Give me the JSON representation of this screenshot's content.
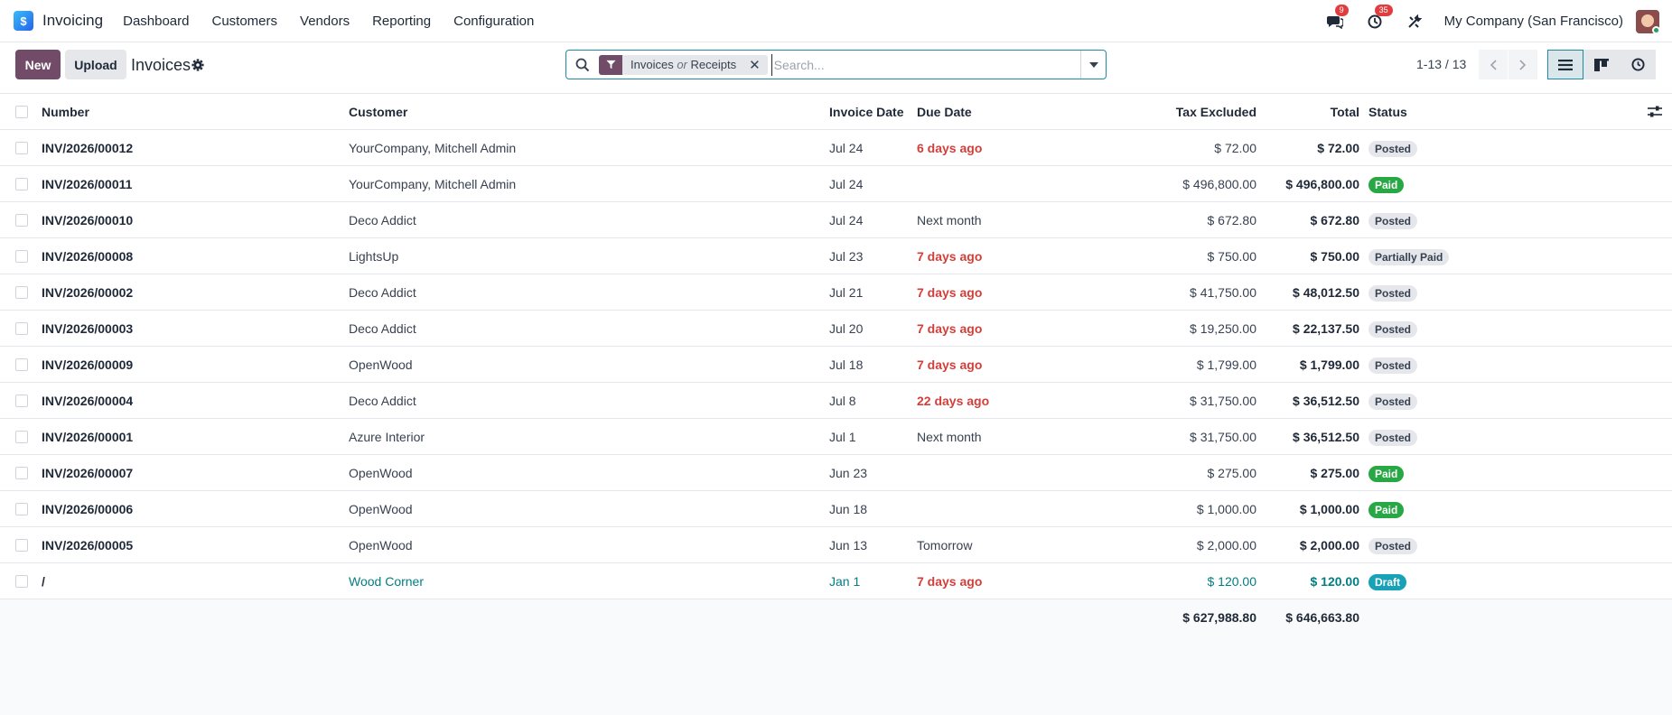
{
  "app": {
    "name": "Invoicing"
  },
  "menu": [
    "Dashboard",
    "Customers",
    "Vendors",
    "Reporting",
    "Configuration"
  ],
  "nav": {
    "messages_count": "9",
    "activities_count": "35",
    "company": "My Company (San Francisco)"
  },
  "control": {
    "new_label": "New",
    "upload_label": "Upload",
    "breadcrumb": "Invoices",
    "facet_a": "Invoices",
    "facet_or": "or",
    "facet_b": "Receipts",
    "search_placeholder": "Search...",
    "pager": "1-13 / 13"
  },
  "columns": {
    "number": "Number",
    "customer": "Customer",
    "invoice_date": "Invoice Date",
    "due_date": "Due Date",
    "tax_excluded": "Tax Excluded",
    "total": "Total",
    "status": "Status"
  },
  "rows": [
    {
      "number": "INV/2026/00012",
      "customer": "YourCompany, Mitchell Admin",
      "invoice_date": "Jul 24",
      "due_date": "6 days ago",
      "overdue": true,
      "tax_excluded": "$ 72.00",
      "total": "$ 72.00",
      "status": "Posted"
    },
    {
      "number": "INV/2026/00011",
      "customer": "YourCompany, Mitchell Admin",
      "invoice_date": "Jul 24",
      "due_date": "",
      "overdue": false,
      "tax_excluded": "$ 496,800.00",
      "total": "$ 496,800.00",
      "status": "Paid"
    },
    {
      "number": "INV/2026/00010",
      "customer": "Deco Addict",
      "invoice_date": "Jul 24",
      "due_date": "Next month",
      "overdue": false,
      "tax_excluded": "$ 672.80",
      "total": "$ 672.80",
      "status": "Posted"
    },
    {
      "number": "INV/2026/00008",
      "customer": "LightsUp",
      "invoice_date": "Jul 23",
      "due_date": "7 days ago",
      "overdue": true,
      "tax_excluded": "$ 750.00",
      "total": "$ 750.00",
      "status": "Partially Paid"
    },
    {
      "number": "INV/2026/00002",
      "customer": "Deco Addict",
      "invoice_date": "Jul 21",
      "due_date": "7 days ago",
      "overdue": true,
      "tax_excluded": "$ 41,750.00",
      "total": "$ 48,012.50",
      "status": "Posted"
    },
    {
      "number": "INV/2026/00003",
      "customer": "Deco Addict",
      "invoice_date": "Jul 20",
      "due_date": "7 days ago",
      "overdue": true,
      "tax_excluded": "$ 19,250.00",
      "total": "$ 22,137.50",
      "status": "Posted"
    },
    {
      "number": "INV/2026/00009",
      "customer": "OpenWood",
      "invoice_date": "Jul 18",
      "due_date": "7 days ago",
      "overdue": true,
      "tax_excluded": "$ 1,799.00",
      "total": "$ 1,799.00",
      "status": "Posted"
    },
    {
      "number": "INV/2026/00004",
      "customer": "Deco Addict",
      "invoice_date": "Jul 8",
      "due_date": "22 days ago",
      "overdue": true,
      "tax_excluded": "$ 31,750.00",
      "total": "$ 36,512.50",
      "status": "Posted"
    },
    {
      "number": "INV/2026/00001",
      "customer": "Azure Interior",
      "invoice_date": "Jul 1",
      "due_date": "Next month",
      "overdue": false,
      "tax_excluded": "$ 31,750.00",
      "total": "$ 36,512.50",
      "status": "Posted"
    },
    {
      "number": "INV/2026/00007",
      "customer": "OpenWood",
      "invoice_date": "Jun 23",
      "due_date": "",
      "overdue": false,
      "tax_excluded": "$ 275.00",
      "total": "$ 275.00",
      "status": "Paid"
    },
    {
      "number": "INV/2026/00006",
      "customer": "OpenWood",
      "invoice_date": "Jun 18",
      "due_date": "",
      "overdue": false,
      "tax_excluded": "$ 1,000.00",
      "total": "$ 1,000.00",
      "status": "Paid"
    },
    {
      "number": "INV/2026/00005",
      "customer": "OpenWood",
      "invoice_date": "Jun 13",
      "due_date": "Tomorrow",
      "overdue": false,
      "tax_excluded": "$ 2,000.00",
      "total": "$ 2,000.00",
      "status": "Posted"
    },
    {
      "number": "/",
      "customer": "Wood Corner",
      "invoice_date": "Jan 1",
      "due_date": "7 days ago",
      "overdue": true,
      "tax_excluded": "$ 120.00",
      "total": "$ 120.00",
      "status": "Draft",
      "draft": true
    }
  ],
  "totals": {
    "tax_excluded": "$ 627,988.80",
    "total": "$ 646,663.80"
  },
  "colors": {
    "brand": "#714b67",
    "accent": "#1d8ca3",
    "overdue": "#d23f3a",
    "paid": "#28a745",
    "draft": "#17a2b8"
  },
  "icons": [
    "chat-icon",
    "clock-icon",
    "tools-icon",
    "search-icon",
    "filter-icon",
    "gear-icon",
    "list-view-icon",
    "kanban-view-icon",
    "activity-view-icon",
    "optional-columns-icon"
  ]
}
